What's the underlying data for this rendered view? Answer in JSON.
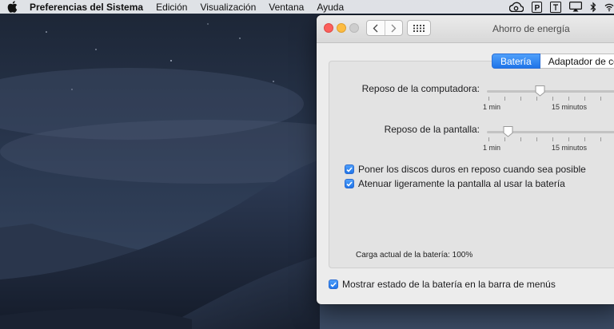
{
  "menubar": {
    "app_name": "Preferencias del Sistema",
    "items": [
      "Edición",
      "Visualización",
      "Ventana",
      "Ayuda"
    ]
  },
  "status_icons": [
    "creative-cloud-icon",
    "parking-icon",
    "tv-icon",
    "airplay-icon",
    "bluetooth-icon",
    "wifi-icon"
  ],
  "window": {
    "title": "Ahorro de energía"
  },
  "tabs": {
    "active": "Batería",
    "inactive": "Adaptador de corr"
  },
  "sliders": {
    "computer": {
      "label": "Reposo de la computadora:",
      "min_label": "1 min",
      "mid_label": "15 minutos",
      "value": 0.35
    },
    "display": {
      "label": "Reposo de la pantalla:",
      "min_label": "1 min",
      "mid_label": "15 minutos",
      "value": 0.12
    }
  },
  "checkboxes": {
    "disks": {
      "label": "Poner los discos duros en reposo cuando sea posible",
      "checked": true
    },
    "dim": {
      "label": "Atenuar ligeramente la pantalla al usar la batería",
      "checked": true
    },
    "menu": {
      "label": "Mostrar estado de la batería en la barra de menús",
      "checked": true
    }
  },
  "battery_charge": "Carga actual de la batería: 100%",
  "colors": {
    "accent": "#1f74e8",
    "close": "#fc605c",
    "minimize": "#fdbc40",
    "zoom": "#cdcdcd"
  }
}
